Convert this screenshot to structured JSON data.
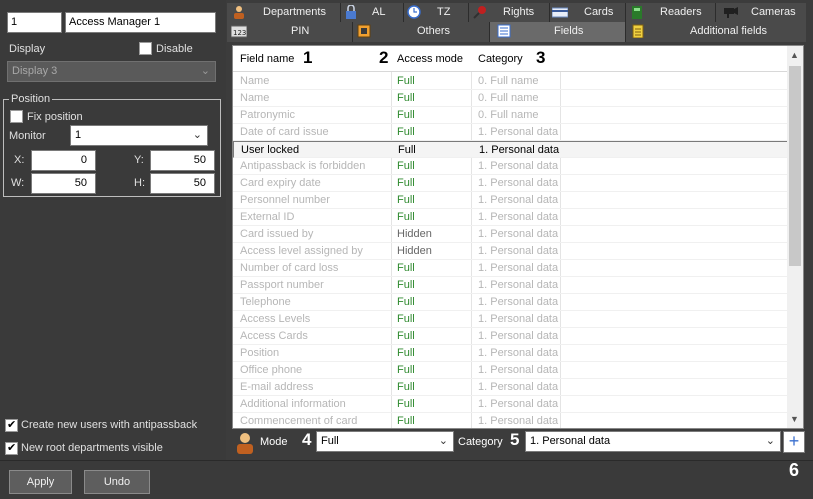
{
  "left": {
    "id_value": "1",
    "name_value": "Access Manager 1",
    "display_label": "Display",
    "disable_label": "Disable",
    "display_select": "Display 3",
    "position_title": "Position",
    "fix_position_label": "Fix position",
    "monitor_label": "Monitor",
    "monitor_value": "1",
    "x_label": "X:",
    "x_value": "0",
    "y_label": "Y:",
    "y_value": "50",
    "w_label": "W:",
    "w_value": "50",
    "h_label": "H:",
    "h_value": "50",
    "create_users_label": "Create new users with antipassback",
    "root_depts_label": "New root departments visible"
  },
  "bottom": {
    "apply_label": "Apply",
    "undo_label": "Undo",
    "marker6": "6"
  },
  "tabs_row1": [
    {
      "label": "Departments",
      "icon": "person-icon"
    },
    {
      "label": "AL",
      "icon": "lock-icon"
    },
    {
      "label": "TZ",
      "icon": "clock-icon"
    },
    {
      "label": "Rights",
      "icon": "key-icon"
    },
    {
      "label": "Cards",
      "icon": "card-icon"
    },
    {
      "label": "Readers",
      "icon": "reader-icon"
    },
    {
      "label": "Cameras",
      "icon": "camera-icon"
    }
  ],
  "tabs_row2": [
    {
      "label": "PIN",
      "icon": "keypad-icon"
    },
    {
      "label": "Others",
      "icon": "others-icon"
    },
    {
      "label": "Fields",
      "icon": "fields-icon",
      "active": true
    },
    {
      "label": "Additional fields",
      "icon": "notes-icon"
    }
  ],
  "table": {
    "headers": [
      "Field name",
      "Access mode",
      "Category"
    ],
    "markers": [
      "1",
      "2",
      "3"
    ],
    "rows": [
      {
        "name": "Name",
        "mode": "Full",
        "category": "0. Full name"
      },
      {
        "name": "Name",
        "mode": "Full",
        "category": "0. Full name"
      },
      {
        "name": "Patronymic",
        "mode": "Full",
        "category": "0. Full name"
      },
      {
        "name": "Date of card issue",
        "mode": "Full",
        "category": "1. Personal data"
      },
      {
        "name": "User locked",
        "mode": "Full",
        "category": "1. Personal data",
        "selected": true
      },
      {
        "name": "Antipassback is forbidden",
        "mode": "Full",
        "category": "1. Personal data"
      },
      {
        "name": "Card expiry date",
        "mode": "Full",
        "category": "1. Personal data"
      },
      {
        "name": "Personnel number",
        "mode": "Full",
        "category": "1. Personal data"
      },
      {
        "name": "External ID",
        "mode": "Full",
        "category": "1. Personal data"
      },
      {
        "name": "Card issued by",
        "mode": "Hidden",
        "category": "1. Personal data"
      },
      {
        "name": "Access level assigned by",
        "mode": "Hidden",
        "category": "1. Personal data"
      },
      {
        "name": "Number of card loss",
        "mode": "Full",
        "category": "1. Personal data"
      },
      {
        "name": "Passport number",
        "mode": "Full",
        "category": "1. Personal data"
      },
      {
        "name": "Telephone",
        "mode": "Full",
        "category": "1. Personal data"
      },
      {
        "name": "Access Levels",
        "mode": "Full",
        "category": "1. Personal data"
      },
      {
        "name": "Access Cards",
        "mode": "Full",
        "category": "1. Personal data"
      },
      {
        "name": "Position",
        "mode": "Full",
        "category": "1. Personal data"
      },
      {
        "name": "Office phone",
        "mode": "Full",
        "category": "1. Personal data"
      },
      {
        "name": "E-mail address",
        "mode": "Full",
        "category": "1. Personal data"
      },
      {
        "name": "Additional information",
        "mode": "Full",
        "category": "1. Personal data"
      },
      {
        "name": "Commencement of card",
        "mode": "Full",
        "category": "1. Personal data"
      }
    ]
  },
  "controls": {
    "mode_label": "Mode",
    "mode_marker": "4",
    "mode_value": "Full",
    "category_label": "Category",
    "category_marker": "5",
    "category_value": "1. Personal data",
    "add_symbol": "+"
  }
}
